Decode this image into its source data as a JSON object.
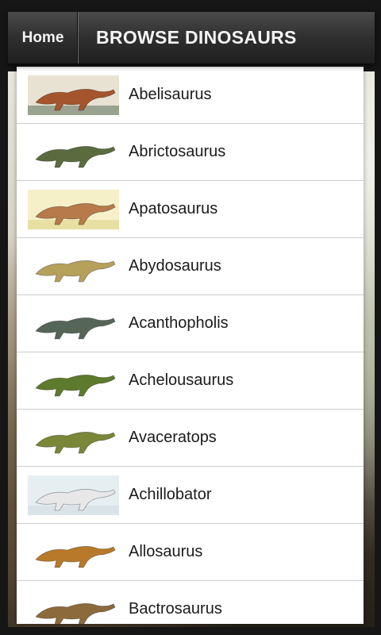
{
  "header": {
    "home_label": "Home",
    "title": "BROWSE DINOSAURS"
  },
  "dinosaurs": [
    {
      "name": "Abelisaurus",
      "icon": "abelisaurus-thumbnail",
      "sky": "#e8e2d2",
      "ground": "#9aa290",
      "body": "#a5552d"
    },
    {
      "name": "Abrictosaurus",
      "icon": "abrictosaurus-thumbnail",
      "sky": "#ffffff",
      "ground": "#ffffff",
      "body": "#5b6b3f"
    },
    {
      "name": "Apatosaurus",
      "icon": "apatosaurus-thumbnail",
      "sky": "#f5f0c8",
      "ground": "#e8dfa2",
      "body": "#b77a4a"
    },
    {
      "name": "Abydosaurus",
      "icon": "abydosaurus-thumbnail",
      "sky": "#ffffff",
      "ground": "#ffffff",
      "body": "#b5a15c"
    },
    {
      "name": "Acanthopholis",
      "icon": "acanthopholis-thumbnail",
      "sky": "#ffffff",
      "ground": "#ffffff",
      "body": "#556659"
    },
    {
      "name": "Achelousaurus",
      "icon": "achelousaurus-thumbnail",
      "sky": "#ffffff",
      "ground": "#ffffff",
      "body": "#5e7a2d"
    },
    {
      "name": "Avaceratops",
      "icon": "avaceratops-thumbnail",
      "sky": "#ffffff",
      "ground": "#ffffff",
      "body": "#7b8738"
    },
    {
      "name": "Achillobator",
      "icon": "achillobator-thumbnail",
      "sky": "#e6eef2",
      "ground": "#d9e3e8",
      "body": "#e8e8e8"
    },
    {
      "name": "Allosaurus",
      "icon": "allosaurus-thumbnail",
      "sky": "#ffffff",
      "ground": "#ffffff",
      "body": "#b87a2a"
    },
    {
      "name": "Bactrosaurus",
      "icon": "bactrosaurus-thumbnail",
      "sky": "#ffffff",
      "ground": "#ffffff",
      "body": "#8c6a3c"
    }
  ]
}
